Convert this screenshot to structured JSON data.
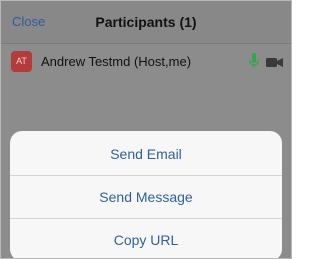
{
  "header": {
    "close_label": "Close",
    "title": "Participants (1)"
  },
  "participants": [
    {
      "initials": "AT",
      "name": "Andrew Testmd (Host,me)",
      "avatar_color": "#b33b3b",
      "mic_icon": "microphone-icon",
      "mic_color": "#2fa84f",
      "video_icon": "video-camera-icon",
      "video_color": "#3a3a3a"
    }
  ],
  "action_sheet": {
    "items": [
      {
        "label": "Send Email"
      },
      {
        "label": "Send Message"
      },
      {
        "label": "Copy URL"
      }
    ]
  },
  "colors": {
    "link": "#2f5fa3",
    "overlay": "#8c8c8c"
  }
}
